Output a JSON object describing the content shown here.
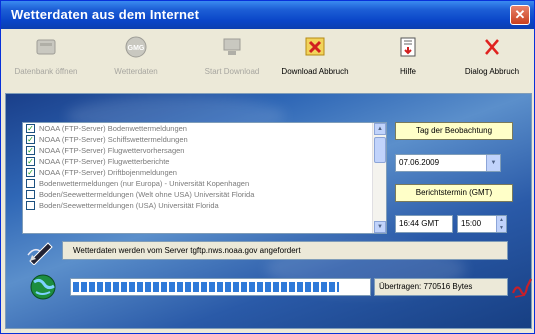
{
  "window": {
    "title": "Wetterdaten aus dem Internet",
    "close_glyph": "✕"
  },
  "toolbar": {
    "buttons": [
      {
        "label": "Datenbank öffnen",
        "icon": "database-icon",
        "enabled": false
      },
      {
        "label": "Wetterdaten",
        "icon": "gmg-icon",
        "enabled": false
      },
      {
        "label": "Start Download",
        "icon": "computer-download-icon",
        "enabled": false
      },
      {
        "label": "Download Abbruch",
        "icon": "cancel-download-icon",
        "enabled": true
      },
      {
        "label": "Hilfe",
        "icon": "help-icon",
        "enabled": true
      },
      {
        "label": "Dialog Abbruch",
        "icon": "close-icon",
        "enabled": true
      }
    ]
  },
  "list": {
    "items": [
      {
        "label": "NOAA (FTP-Server) Bodenwettermeldungen",
        "checked": true
      },
      {
        "label": "NOAA (FTP-Server) Schiffswettermeldungen",
        "checked": true
      },
      {
        "label": "NOAA (FTP-Server) Flugwettervorhersagen",
        "checked": true
      },
      {
        "label": "NOAA (FTP-Server) Flugwetterberichte",
        "checked": true
      },
      {
        "label": "NOAA (FTP-Server) Driftbojenmeldungen",
        "checked": true
      },
      {
        "label": "Bodenwettermeldungen (nur Europa) - Universität Kopenhagen",
        "checked": false
      },
      {
        "label": "Boden/Seewettermeldungen (Welt ohne USA) Universität Florida",
        "checked": false
      },
      {
        "label": "Boden/Seewettermeldungen (USA) Universität Florida",
        "checked": false
      }
    ]
  },
  "observation": {
    "day_label": "Tag der Beobachtung",
    "date_value": "07.06.2009",
    "report_label": "Berichtstermin (GMT)",
    "gmt_value": "16:44 GMT",
    "time_value": "15:00"
  },
  "status": {
    "message": "Wetterdaten werden vom Server tgftp.nws.noaa.gov angefordert",
    "progress": 0.9,
    "transferred": "Übertragen: 770516 Bytes"
  },
  "colors": {
    "title_bar": "#0a46c8",
    "panel": "#2f67b6",
    "progress_fill": "#2f7ad9",
    "label_bg": "#ffffc8"
  }
}
